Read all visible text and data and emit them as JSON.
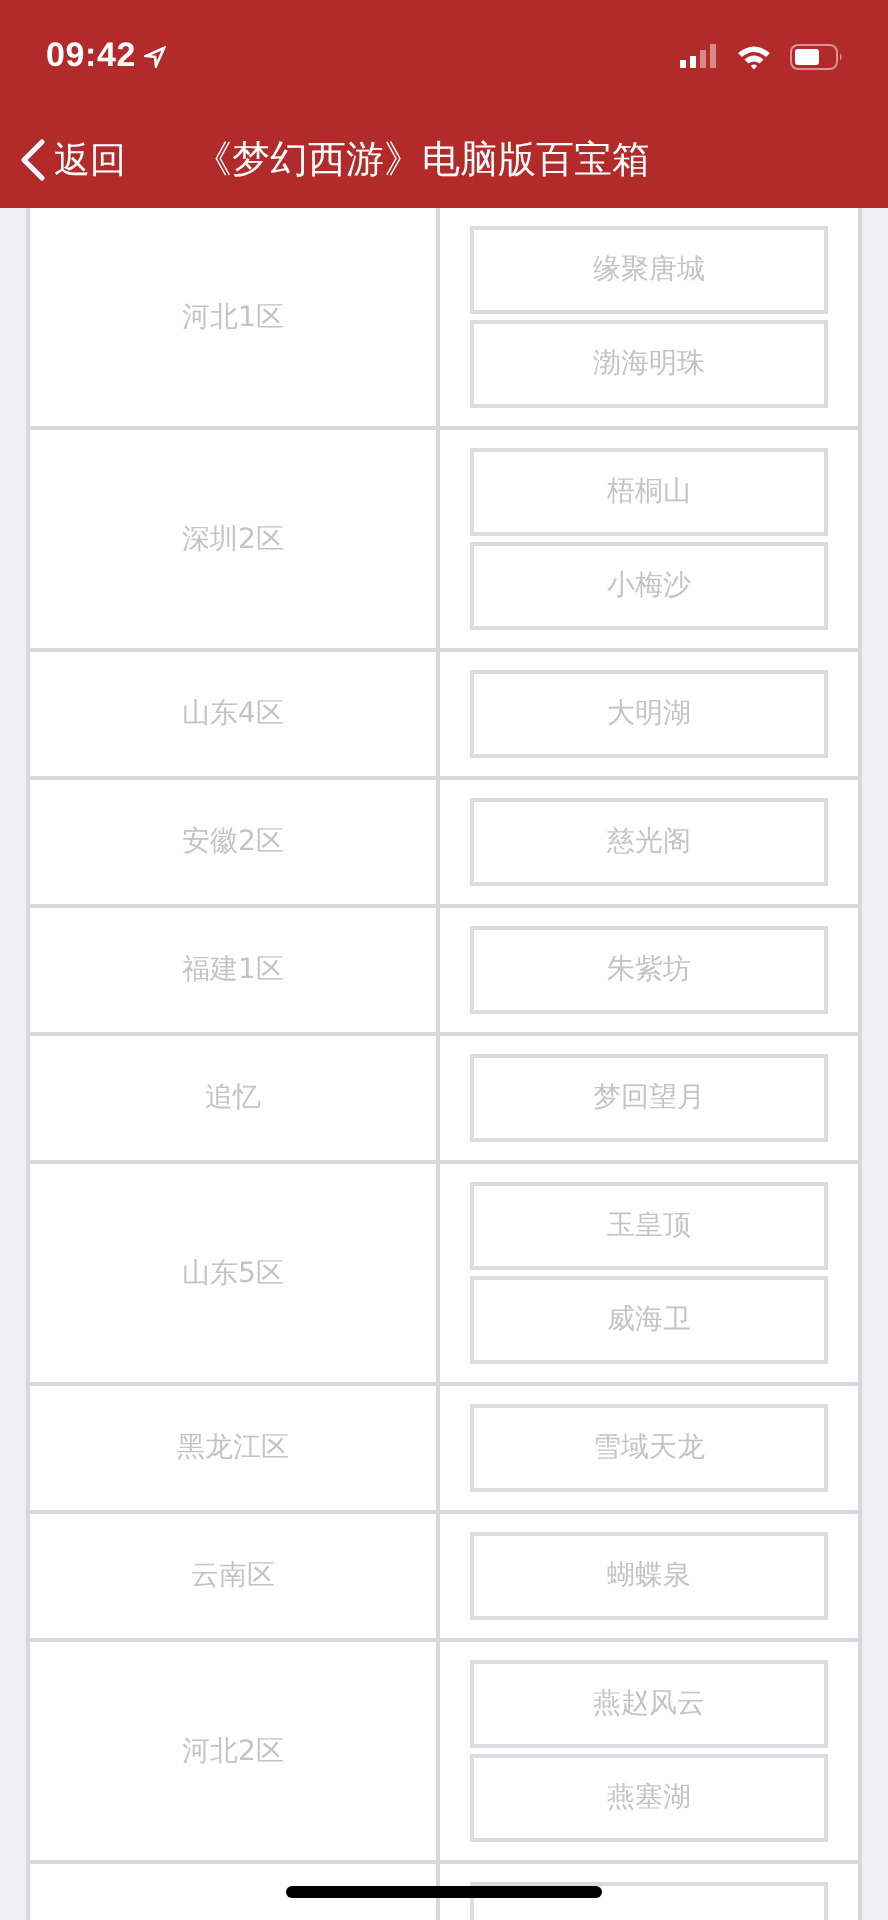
{
  "status_bar": {
    "time": "09:42"
  },
  "nav": {
    "back": "返回",
    "title": "《梦幻西游》电脑版百宝箱"
  },
  "rows": [
    {
      "region": "河北1区",
      "servers": [
        "缘聚唐城",
        "渤海明珠"
      ]
    },
    {
      "region": "深圳2区",
      "servers": [
        "梧桐山",
        "小梅沙"
      ]
    },
    {
      "region": "山东4区",
      "servers": [
        "大明湖"
      ]
    },
    {
      "region": "安徽2区",
      "servers": [
        "慈光阁"
      ]
    },
    {
      "region": "福建1区",
      "servers": [
        "朱紫坊"
      ]
    },
    {
      "region": "追忆",
      "servers": [
        "梦回望月"
      ]
    },
    {
      "region": "山东5区",
      "servers": [
        "玉皇顶",
        "威海卫"
      ]
    },
    {
      "region": "黑龙江区",
      "servers": [
        "雪域天龙"
      ]
    },
    {
      "region": "云南区",
      "servers": [
        "蝴蝶泉"
      ]
    },
    {
      "region": "河北2区",
      "servers": [
        "燕赵风云",
        "燕塞湖"
      ]
    }
  ]
}
